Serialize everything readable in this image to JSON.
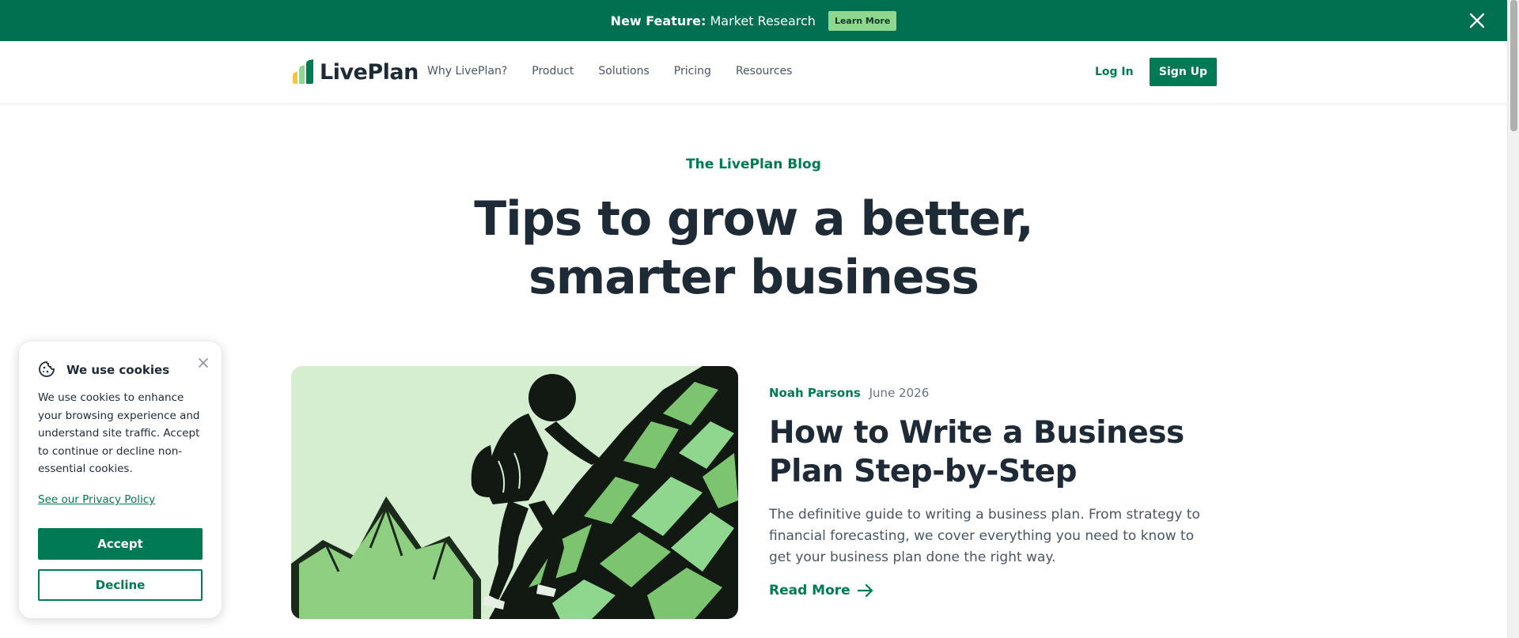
{
  "promo": {
    "feature_label": "New Feature:",
    "feature_name": "Market Research",
    "button_label": "Learn More",
    "close_icon": "close-icon",
    "background_color": "#007050"
  },
  "header": {
    "logo_text": "LivePlan",
    "nav": [
      "Why LivePlan?",
      "Product",
      "Solutions",
      "Pricing",
      "Resources"
    ],
    "login_label": "Log In",
    "signup_label": "Sign Up"
  },
  "hero": {
    "kicker": "The LivePlan Blog",
    "title_line1": "Tips to grow a better,",
    "title_line2": "smarter business"
  },
  "featured": {
    "author": "Noah Parsons",
    "date": "June 2026",
    "title": "How to Write a Business Plan Step-by-Step",
    "description": "The definitive guide to writing a business plan. From strategy to financial forecasting, we cover everything you need to know to get your business plan done the right way.",
    "read_more": "Read More",
    "image_icon": "hiker-climbing-illustration"
  },
  "cookie": {
    "title": "We use cookies",
    "text": "We use cookies to enhance your browsing experience and understand site traffic. Accept to continue or decline non-essential cookies.",
    "privacy_link": "See our Privacy Policy",
    "accept_label": "Accept",
    "decline_label": "Decline"
  },
  "colors": {
    "brand_green": "#007a55",
    "text_dark": "#1f2a37",
    "accent_light_green": "#8fd68f"
  }
}
